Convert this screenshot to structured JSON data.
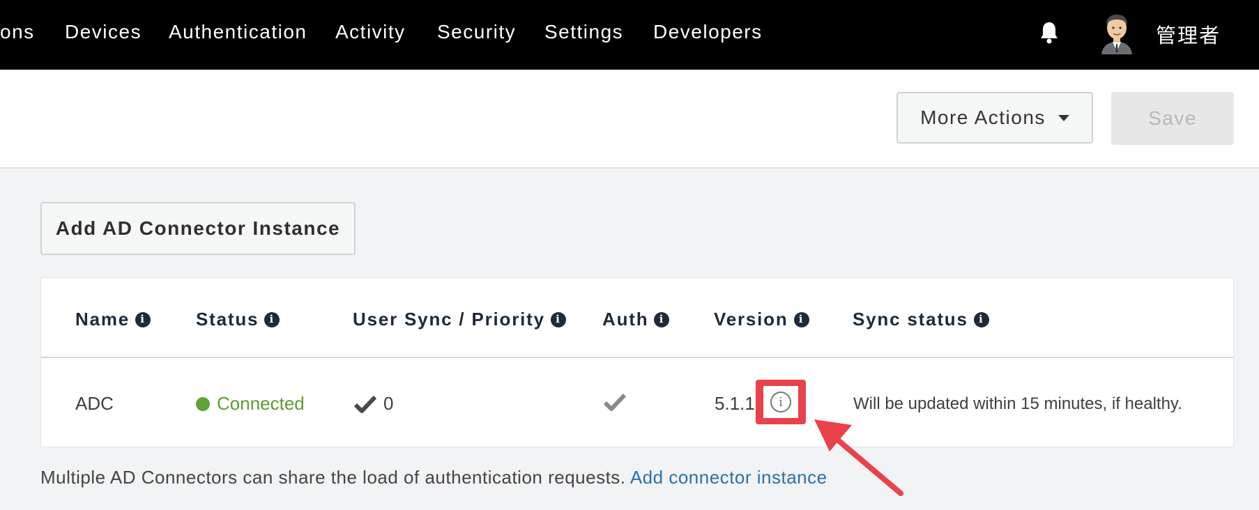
{
  "nav": {
    "items": [
      {
        "label": "ons"
      },
      {
        "label": "Devices"
      },
      {
        "label": "Authentication"
      },
      {
        "label": "Activity"
      },
      {
        "label": "Security"
      },
      {
        "label": "Settings"
      },
      {
        "label": "Developers"
      }
    ],
    "icons": {
      "notifications": "bell-icon",
      "avatar": "avatar-icon"
    },
    "user_name": "管理者"
  },
  "header": {
    "more_actions_label": "More Actions",
    "save_label": "Save"
  },
  "add_instance_label": "Add AD Connector Instance",
  "table": {
    "columns": [
      {
        "label": "Name"
      },
      {
        "label": "Status"
      },
      {
        "label": "User Sync / Priority"
      },
      {
        "label": "Auth"
      },
      {
        "label": "Version"
      },
      {
        "label": "Sync status"
      }
    ],
    "rows": [
      {
        "name": "ADC",
        "status": "Connected",
        "user_sync": "0",
        "version": "5.1.1",
        "sync_status": "Will be updated within 15 minutes, if healthy."
      }
    ]
  },
  "footer": {
    "text": "Multiple AD Connectors can share the load of authentication requests.",
    "link": "Add connector instance"
  },
  "colors": {
    "nav_bg": "#000000",
    "connected": "#5a9e2f",
    "link": "#2a72a8",
    "highlight": "#e9424b"
  }
}
